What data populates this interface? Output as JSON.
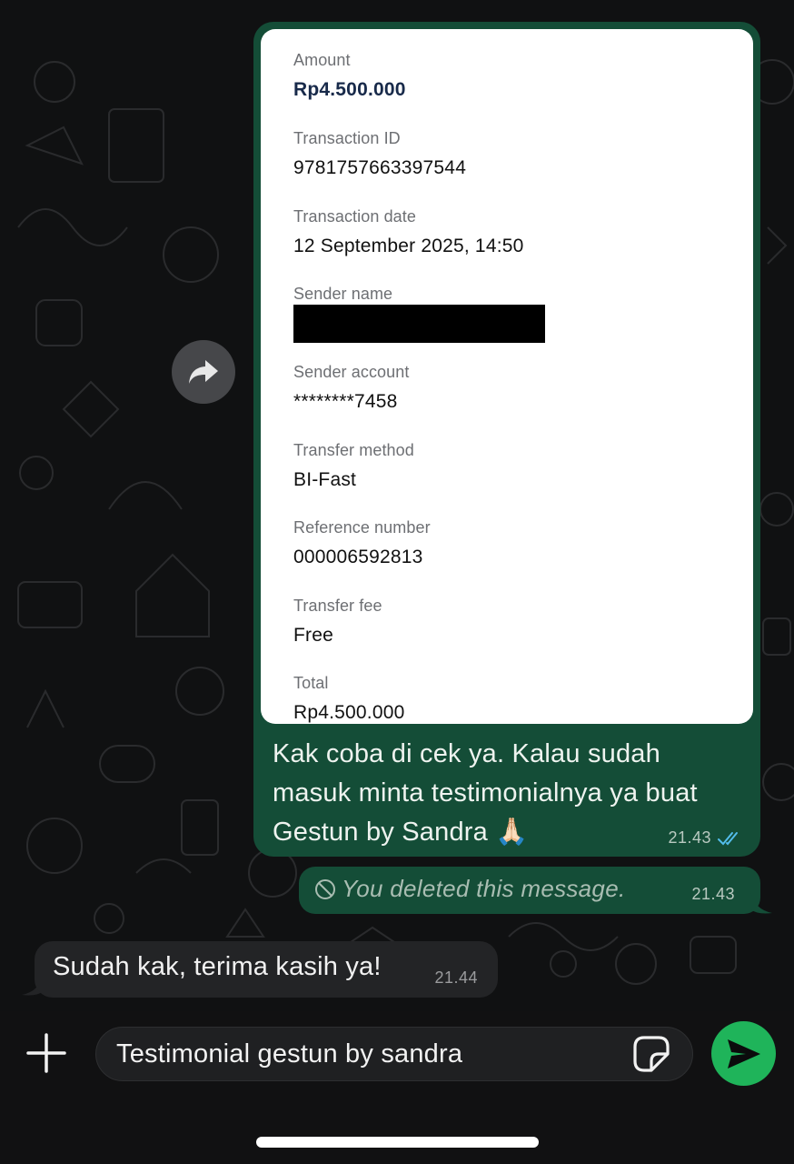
{
  "receipt": {
    "fields": [
      {
        "label": "Amount",
        "value": "Rp4.500.000"
      },
      {
        "label": "Transaction ID",
        "value": "9781757663397544"
      },
      {
        "label": "Transaction date",
        "value": "12 September 2025, 14:50"
      },
      {
        "label": "Sender name",
        "value": ""
      },
      {
        "label": "Sender account",
        "value": "********7458"
      },
      {
        "label": "Transfer method",
        "value": "BI-Fast"
      },
      {
        "label": "Reference number",
        "value": "000006592813"
      },
      {
        "label": "Transfer fee",
        "value": "Free"
      },
      {
        "label": "Total",
        "value": "Rp4.500.000"
      }
    ]
  },
  "outgoing_message": {
    "text": "Kak coba di cek ya. Kalau sudah masuk minta testimonialnya ya buat Gestun by Sandra 🙏🏻",
    "time": "21.43",
    "status_icon": "double-check-read-icon"
  },
  "deleted_message": {
    "text": "You deleted this message.",
    "time": "21.43",
    "icon": "deleted-ban-icon"
  },
  "incoming_message": {
    "text": "Sudah kak, terima kasih ya!",
    "time": "21.44"
  },
  "composer": {
    "value": "Testimonial gestun by sandra",
    "plus_icon": "plus-icon",
    "sticker_icon": "sticker-icon",
    "send_icon": "send-icon"
  },
  "colors": {
    "outgoing_bubble": "#144d37",
    "incoming_bubble": "#232426",
    "send_button": "#1fb45a",
    "read_ticks": "#53bdeb"
  }
}
